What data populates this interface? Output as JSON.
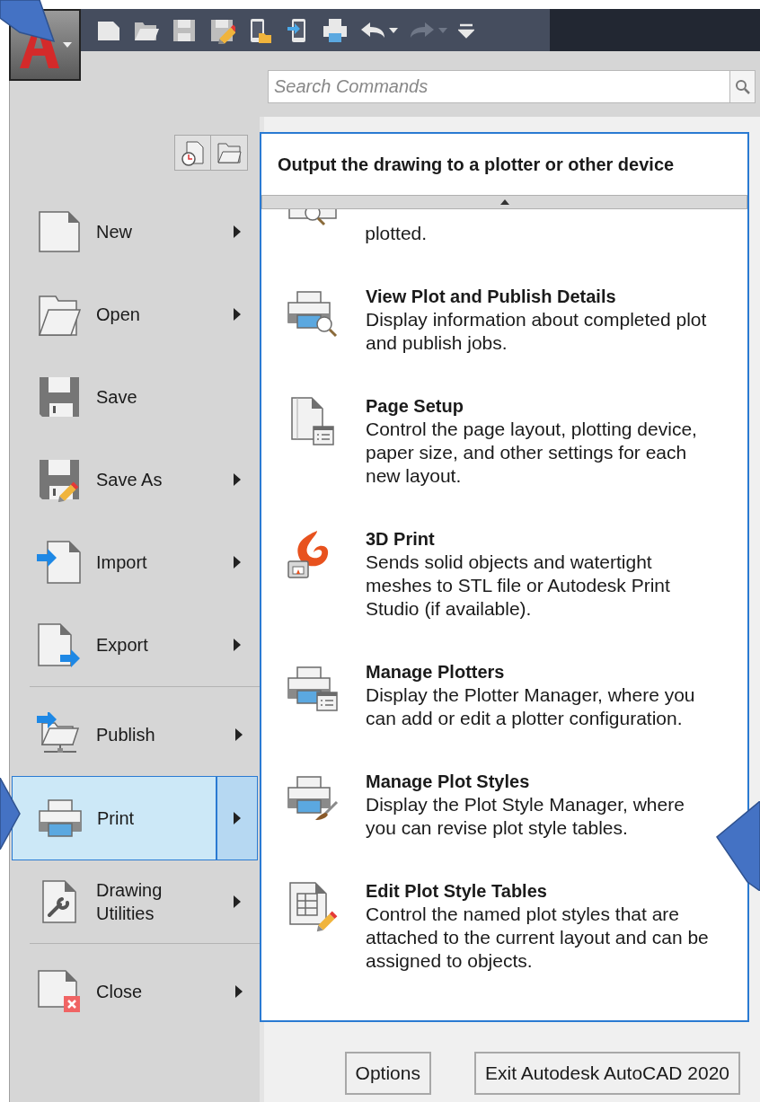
{
  "quick_access": [
    {
      "kind": "new",
      "disabled": false
    },
    {
      "kind": "open",
      "disabled": false
    },
    {
      "kind": "save",
      "disabled": false
    },
    {
      "kind": "saveas",
      "disabled": false
    },
    {
      "kind": "open-mobile",
      "disabled": false
    },
    {
      "kind": "save-mobile",
      "disabled": false
    },
    {
      "kind": "print",
      "disabled": false
    },
    {
      "kind": "undo",
      "disabled": false
    },
    {
      "kind": "redo",
      "disabled": true
    },
    {
      "kind": "customize",
      "disabled": false
    }
  ],
  "search": {
    "placeholder": "Search Commands"
  },
  "menu": [
    {
      "label": "New",
      "kind": "new",
      "submenu": true,
      "selected": false,
      "separator_before": false
    },
    {
      "label": "Open",
      "kind": "open",
      "submenu": true,
      "selected": false,
      "separator_before": false
    },
    {
      "label": "Save",
      "kind": "save",
      "submenu": false,
      "selected": false,
      "separator_before": false
    },
    {
      "label": "Save As",
      "kind": "saveas",
      "submenu": true,
      "selected": false,
      "separator_before": false
    },
    {
      "label": "Import",
      "kind": "import",
      "submenu": true,
      "selected": false,
      "separator_before": false
    },
    {
      "label": "Export",
      "kind": "export",
      "submenu": true,
      "selected": false,
      "separator_before": false
    },
    {
      "label": "Publish",
      "kind": "publish",
      "submenu": true,
      "selected": false,
      "separator_before": true
    },
    {
      "label": "Print",
      "kind": "print",
      "submenu": true,
      "selected": true,
      "separator_before": false
    },
    {
      "label": "Drawing Utilities",
      "kind": "utilities",
      "submenu": true,
      "selected": false,
      "separator_before": false
    },
    {
      "label": "Close",
      "kind": "close",
      "submenu": true,
      "selected": false,
      "separator_before": true
    }
  ],
  "panel": {
    "title": "Output the drawing to a plotter or other device",
    "items": [
      {
        "kind": "preview",
        "description": "plotted."
      },
      {
        "kind": "details",
        "title": "View Plot and Publish Details",
        "description": "Display information about completed plot and publish jobs."
      },
      {
        "kind": "pagesetup",
        "title": "Page Setup",
        "description": "Control the page layout, plotting device, paper size, and other settings for each new layout."
      },
      {
        "kind": "threed",
        "title": "3D Print",
        "description": "Sends solid objects and watertight meshes to STL file or Autodesk Print Studio (if available)."
      },
      {
        "kind": "plotters",
        "title": "Manage Plotters",
        "description": "Display the Plotter Manager, where you can add or edit a plotter configuration."
      },
      {
        "kind": "plotstyles",
        "title": "Manage Plot Styles",
        "description": "Display the Plot Style Manager, where you can revise plot style tables."
      },
      {
        "kind": "edittables",
        "title": "Edit Plot Style Tables",
        "description": "Control the named plot styles that are attached to the current layout and can be assigned to objects."
      }
    ]
  },
  "buttons": [
    "Options",
    "Exit Autodesk AutoCAD 2020"
  ]
}
